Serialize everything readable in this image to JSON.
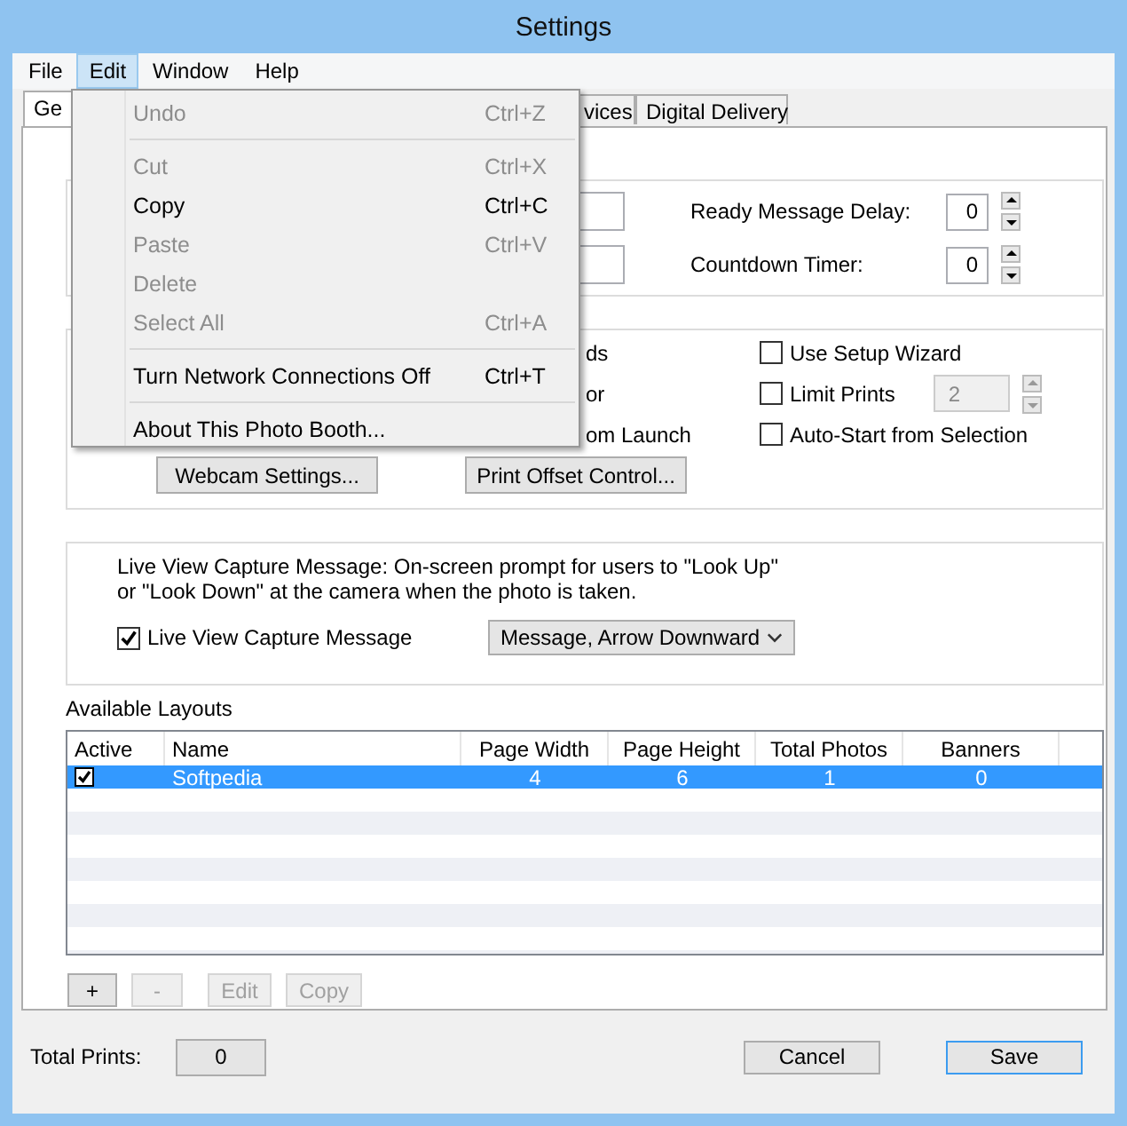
{
  "window": {
    "title": "Settings"
  },
  "menu_bar": [
    {
      "label": "File",
      "selected": false
    },
    {
      "label": "Edit",
      "selected": true
    },
    {
      "label": "Window",
      "selected": false
    },
    {
      "label": "Help",
      "selected": false
    }
  ],
  "edit_menu": [
    {
      "kind": "item",
      "label": "Undo",
      "shortcut": "Ctrl+Z",
      "disabled": true
    },
    {
      "kind": "separator"
    },
    {
      "kind": "item",
      "label": "Cut",
      "shortcut": "Ctrl+X",
      "disabled": true
    },
    {
      "kind": "item",
      "label": "Copy",
      "shortcut": "Ctrl+C",
      "disabled": false
    },
    {
      "kind": "item",
      "label": "Paste",
      "shortcut": "Ctrl+V",
      "disabled": true
    },
    {
      "kind": "item",
      "label": "Delete",
      "disabled": true
    },
    {
      "kind": "item",
      "label": "Select All",
      "shortcut": "Ctrl+A",
      "disabled": true
    },
    {
      "kind": "separator"
    },
    {
      "kind": "item",
      "label": "Turn Network Connections Off",
      "shortcut": "Ctrl+T",
      "disabled": false
    },
    {
      "kind": "separator"
    },
    {
      "kind": "item",
      "label": "About This Photo Booth...",
      "disabled": false
    }
  ],
  "tabs": [
    {
      "label": "Ge",
      "selected": true
    },
    {
      "label": "vices",
      "selected": false
    },
    {
      "label": "Digital Delivery",
      "selected": false
    }
  ],
  "timing": [
    {
      "label": "Ready Message Delay:",
      "value": "0"
    },
    {
      "label": "Countdown Timer:",
      "value": "0"
    }
  ],
  "options": {
    "left_labels": [
      "ds",
      "or",
      "om Launch"
    ],
    "checkboxes": [
      {
        "label": "Use Setup Wizard",
        "checked": false
      },
      {
        "label": "Limit Prints",
        "checked": false,
        "spinner": {
          "value": "2",
          "disabled": true
        }
      },
      {
        "label": "Auto-Start from Selection",
        "checked": false
      }
    ],
    "buttons": [
      "Webcam Settings...",
      "Print Offset Control..."
    ]
  },
  "live_view": {
    "description": "Live View Capture Message: On-screen prompt for users to \"Look Up\" or \"Look Down\" at the camera when the photo is taken.",
    "checkbox": {
      "label": "Live View Capture Message",
      "checked": true
    },
    "dropdown": {
      "value": "Message, Arrow Downward"
    }
  },
  "layouts": {
    "title": "Available Layouts",
    "columns": [
      "Active",
      "Name",
      "Page Width",
      "Page Height",
      "Total Photos",
      "Banners"
    ],
    "rows": [
      {
        "active": true,
        "selected": true,
        "cells": [
          "",
          "Softpedia",
          "4",
          "6",
          "1",
          "0"
        ]
      }
    ],
    "buttons": [
      {
        "label": "+",
        "disabled": false
      },
      {
        "label": "-",
        "disabled": true
      },
      {
        "label": "Edit",
        "disabled": true
      },
      {
        "label": "Copy",
        "disabled": true
      }
    ]
  },
  "footer": {
    "label": "Total Prints:",
    "value": "0",
    "buttons": [
      {
        "label": "Cancel",
        "default": false
      },
      {
        "label": "Save",
        "default": true
      }
    ]
  }
}
